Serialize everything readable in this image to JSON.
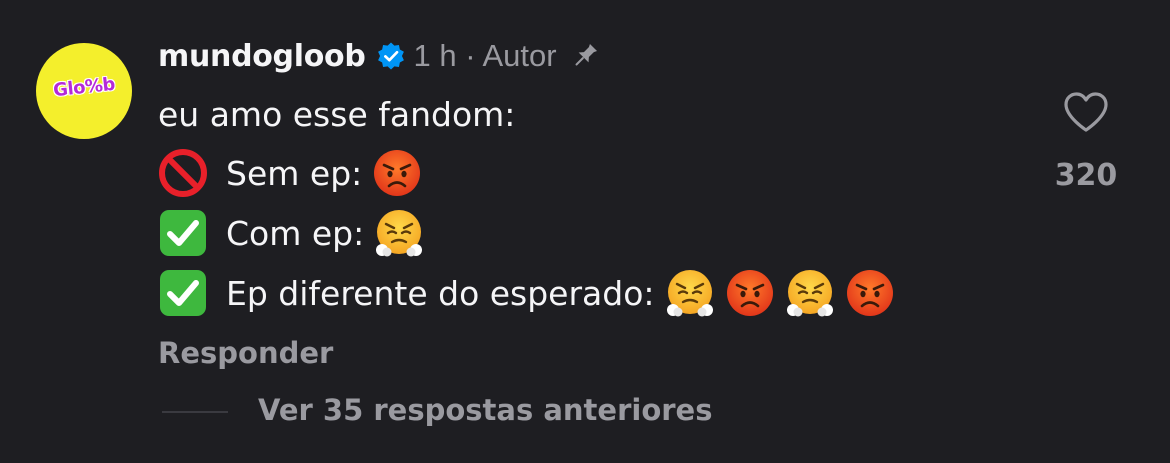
{
  "comment": {
    "avatar_logo_text": "Glo%b",
    "username": "mundogloob",
    "verified_icon": "verified-badge-icon",
    "meta": "1 h · Autor",
    "pin_icon": "pin-icon",
    "lines": [
      {
        "text": "eu amo esse fandom:"
      },
      {
        "prefix_icon": "no-entry-emoji",
        "text": "Sem ep:",
        "suffix_icons": [
          "angry-face-emoji"
        ]
      },
      {
        "prefix_icon": "check-mark-button-emoji",
        "text": "Com ep:",
        "suffix_icons": [
          "face-with-steam-emoji"
        ]
      },
      {
        "prefix_icon": "check-mark-button-emoji",
        "text": "Ep diferente do esperado:",
        "suffix_icons": [
          "face-with-steam-emoji",
          "angry-face-emoji",
          "face-with-steam-emoji",
          "angry-face-emoji"
        ]
      }
    ],
    "like_icon": "heart-icon",
    "like_count": "320",
    "reply_label": "Responder",
    "view_previous_label": "Ver 35 respostas anteriores"
  },
  "colors": {
    "background": "#1e1e22",
    "primary_text": "#f5f5f7",
    "secondary_text": "#9a9aa0",
    "verified_blue": "#0095f6",
    "avatar_bg": "#f4ef2c"
  }
}
